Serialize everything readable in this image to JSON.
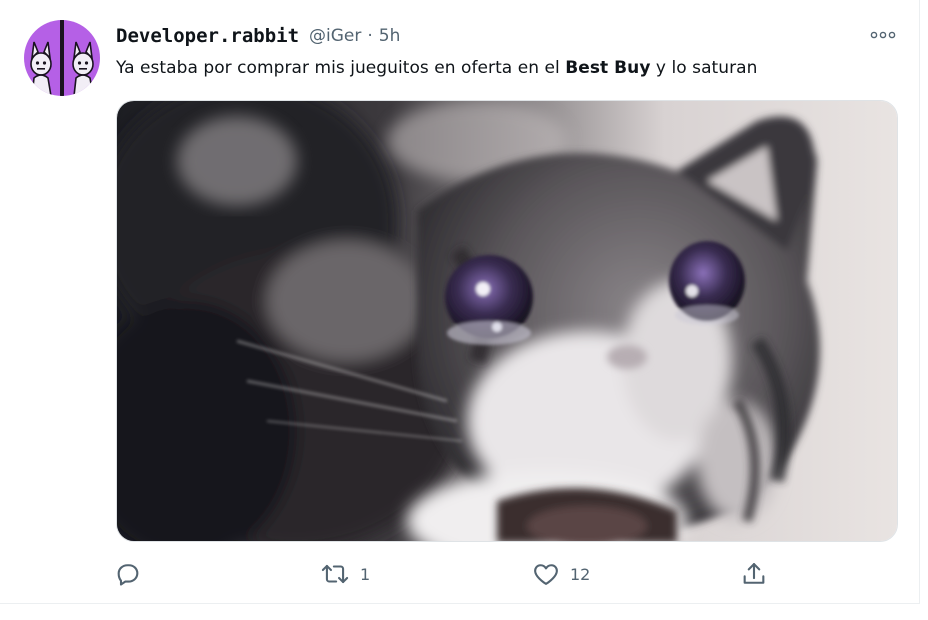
{
  "tweet": {
    "author": {
      "display_name": "Developer.rabbit",
      "handle": "@iGer",
      "separator": "·",
      "time": "5h",
      "avatar": {
        "icon": "twin-rabbit-avatar",
        "colors": {
          "purple": "#b560e6",
          "dark": "#1a1320"
        }
      }
    },
    "text": {
      "before": "Ya estaba por comprar mis jueguitos en oferta en el ",
      "bold": "Best Buy",
      "after": " y lo saturan"
    },
    "media": {
      "kind": "photo",
      "subject_icon": "crying-cat-photo"
    },
    "actions": {
      "reply": {
        "icon": "reply-icon",
        "count": ""
      },
      "retweet": {
        "icon": "retweet-icon",
        "count": "1"
      },
      "like": {
        "icon": "heart-icon",
        "count": "12"
      },
      "share": {
        "icon": "share-icon",
        "count": ""
      }
    },
    "more_icon": "more-options-icon"
  },
  "colors": {
    "text_primary": "#0f1419",
    "text_secondary": "#536471",
    "border": "#eceff1"
  }
}
